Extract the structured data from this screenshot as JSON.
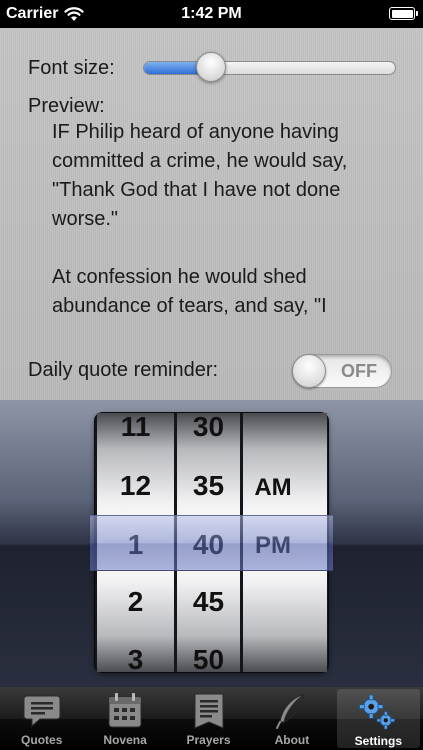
{
  "status_bar": {
    "carrier": "Carrier",
    "time": "1:42 PM",
    "battery_level": 1.0
  },
  "settings": {
    "font_size_label": "Font size:",
    "font_size_value": 0.27,
    "preview_label": "Preview:",
    "preview_text": "IF Philip heard of anyone having committed a crime, he would say, \"Thank God that I have not done worse.\"\n\nAt confession he would shed abundance of tears, and say, \"I",
    "reminder_label": "Daily quote reminder:",
    "reminder_state": "OFF"
  },
  "time_picker": {
    "hours": [
      "11",
      "12",
      "1",
      "2",
      "3"
    ],
    "minutes": [
      "30",
      "35",
      "40",
      "45",
      "50"
    ],
    "periods": [
      "AM",
      "PM"
    ],
    "selected": {
      "hour": "1",
      "minute": "40",
      "period": "PM"
    }
  },
  "tab_bar": {
    "tabs": [
      {
        "label": "Quotes",
        "icon": "speech-bubble-icon",
        "active": false
      },
      {
        "label": "Novena",
        "icon": "calendar-icon",
        "active": false
      },
      {
        "label": "Prayers",
        "icon": "prayer-book-icon",
        "active": false
      },
      {
        "label": "About",
        "icon": "quill-icon",
        "active": false
      },
      {
        "label": "Settings",
        "icon": "gears-icon",
        "active": true
      }
    ]
  },
  "colors": {
    "slider_fill": "#2f6fd6",
    "selection_bar": "#6e7dbe",
    "active_tab_label": "#ffffff",
    "tab_label": "#a6a6a6"
  }
}
